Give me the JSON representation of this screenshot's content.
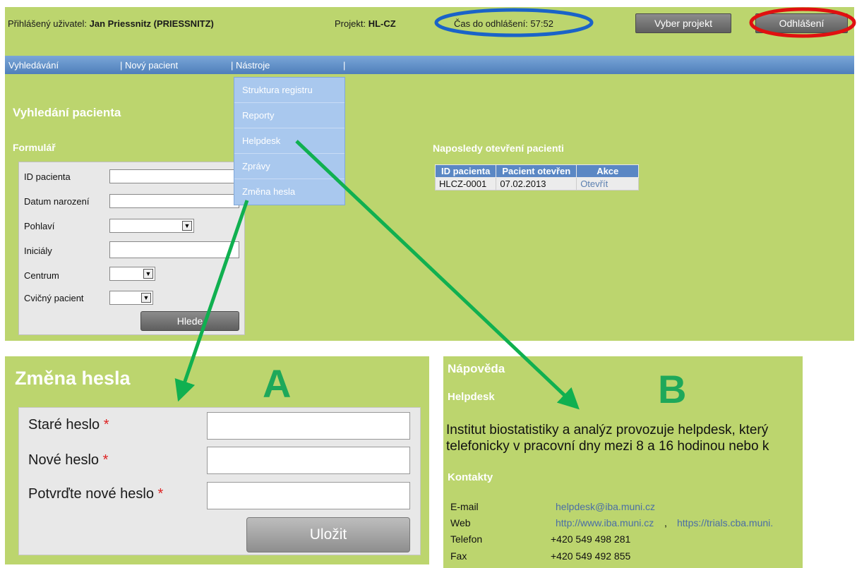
{
  "header": {
    "user_label": "Přihlášený uživatel:",
    "user_name": "Jan Priessnitz (PRIESSNITZ)",
    "project_label": "Projekt:",
    "project_value": "HL-CZ",
    "logout_timer": "Čas do odhlášení: 57:52",
    "select_project_button": "Vyber projekt",
    "logout_button": "Odhlášení"
  },
  "nav": {
    "search": "Vyhledávání",
    "new_patient": "| Nový pacient",
    "tools": "| Nástroje",
    "separator": "|"
  },
  "tools_menu": {
    "items": [
      "Struktura registru",
      "Reporty",
      "Helpdesk",
      "Zprávy",
      "Změna hesla"
    ]
  },
  "search_page": {
    "title": "Vyhledání pacienta",
    "form_title": "Formulář",
    "fields": [
      "ID pacienta",
      "Datum narození",
      "Pohlaví",
      "Iniciály",
      "Centrum",
      "Cvičný pacient"
    ],
    "search_button": "Hlede"
  },
  "recent": {
    "title": "Naposledy otevření pacienti",
    "columns": [
      "ID pacienta",
      "Pacient otevřen",
      "Akce"
    ],
    "rows": [
      {
        "id": "HLCZ-0001",
        "opened": "07.02.2013",
        "action": "Otevřít"
      }
    ]
  },
  "panel_a": {
    "marker": "A",
    "title": "Změna hesla",
    "old_password": "Staré heslo",
    "new_password": "Nové heslo",
    "confirm_password": "Potvrďte nové heslo",
    "required_mark": "*",
    "save_button": "Uložit"
  },
  "panel_b": {
    "marker": "B",
    "title": "Nápověda",
    "subtitle": "Helpdesk",
    "text_line1": "Institut biostatistiky a analýz provozuje helpdesk, který",
    "text_line2": "telefonicky v pracovní dny mezi 8 a 16 hodinou nebo k",
    "contacts_title": "Kontakty",
    "email_label": "E-mail",
    "email_value": "helpdesk@iba.muni.cz",
    "web_label": "Web",
    "web_value1": "http://www.iba.muni.cz",
    "web_sep": ",",
    "web_value2": "https://trials.cba.muni.",
    "phone_label": "Telefon",
    "phone_value": "+420 549 498 281",
    "fax_label": "Fax",
    "fax_value": "+420 549 492 855"
  },
  "colors": {
    "panel_green": "#bcd56e",
    "nav_blue": "#5a87c4",
    "annotation_blue": "#1a63c8",
    "annotation_red": "#e01010",
    "arrow_green": "#10b050"
  }
}
